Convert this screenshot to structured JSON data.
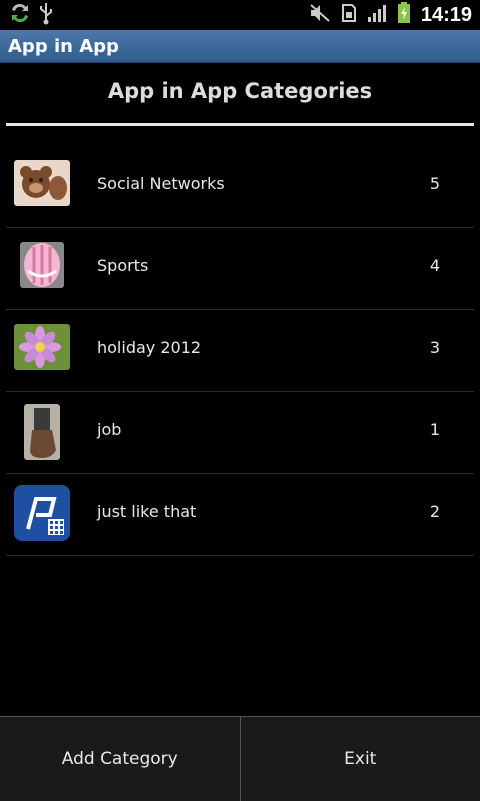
{
  "status_bar": {
    "time": "14:19",
    "icons": [
      "sync-icon",
      "usb-icon",
      "mute-icon",
      "sim-icon",
      "signal-icon",
      "battery-icon"
    ]
  },
  "app_bar": {
    "title": "App in App"
  },
  "screen": {
    "title": "App in App Categories"
  },
  "categories": [
    {
      "label": "Social Networks",
      "count": "5",
      "thumbnail": "teddy-bear-thumb"
    },
    {
      "label": "Sports",
      "count": "4",
      "thumbnail": "helmet-thumb"
    },
    {
      "label": "holiday 2012",
      "count": "3",
      "thumbnail": "flower-thumb"
    },
    {
      "label": "job",
      "count": "1",
      "thumbnail": "boot-thumb"
    },
    {
      "label": "just like that",
      "count": "2",
      "thumbnail": "app-logo-thumb"
    }
  ],
  "bottom_bar": {
    "add_label": "Add Category",
    "exit_label": "Exit"
  },
  "colors": {
    "title_bar": "#3e6aa0",
    "background": "#000000",
    "divider": "#e6e6e6"
  }
}
